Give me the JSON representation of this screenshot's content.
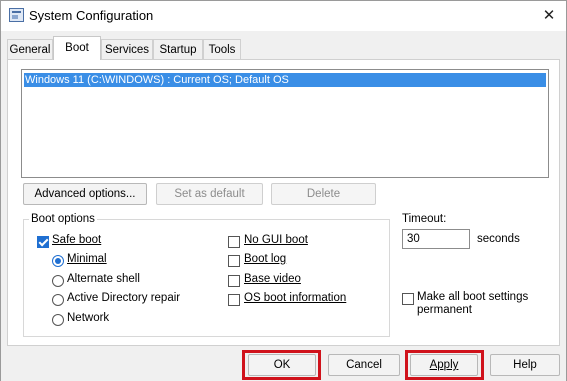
{
  "window": {
    "title": "System Configuration",
    "close_glyph": "✕"
  },
  "tabs": [
    "General",
    "Boot",
    "Services",
    "Startup",
    "Tools"
  ],
  "active_tab": "Boot",
  "os_list": [
    "Windows 11 (C:\\WINDOWS) : Current OS; Default OS"
  ],
  "buttons": {
    "advanced_options": "Advanced options...",
    "set_as_default": "Set as default",
    "delete": "Delete"
  },
  "boot_options": {
    "group_label": "Boot options",
    "safe_boot": "Safe boot",
    "minimal": "Minimal",
    "alternate_shell": "Alternate shell",
    "active_directory_repair": "Active Directory repair",
    "network": "Network",
    "no_gui_boot": "No GUI boot",
    "boot_log": "Boot log",
    "base_video": "Base video",
    "os_boot_information": "OS boot information"
  },
  "timeout": {
    "label": "Timeout:",
    "value": "30",
    "unit": "seconds"
  },
  "make_permanent": {
    "line1": "Make all boot settings",
    "line2": "permanent"
  },
  "footer_buttons": {
    "ok": "OK",
    "cancel": "Cancel",
    "apply": "Apply",
    "help": "Help"
  },
  "colors": {
    "highlight_red": "#d0121b",
    "selection_blue": "#3a8ee6",
    "accent_blue": "#1f6fd1"
  }
}
